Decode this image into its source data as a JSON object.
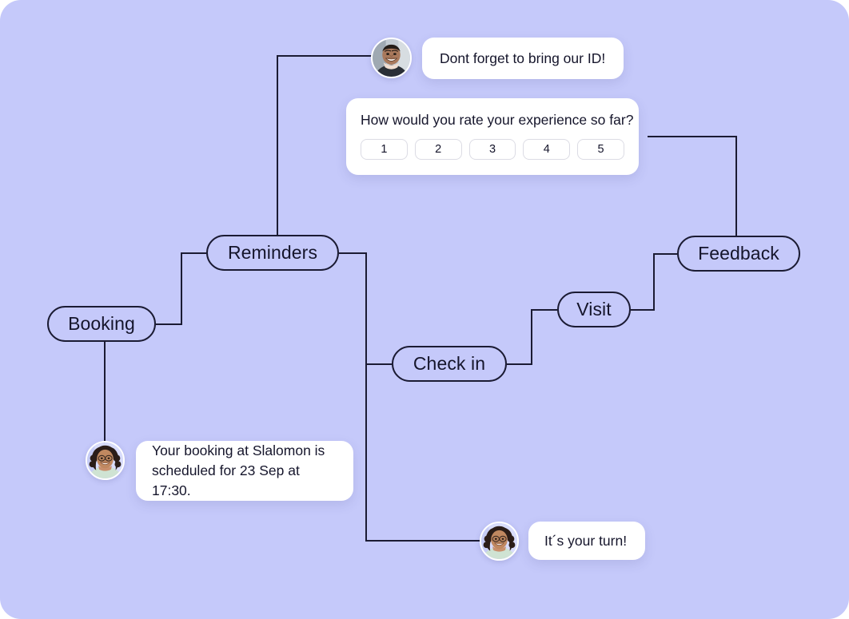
{
  "canvas": {
    "background_color": "#c5c9fa",
    "line_color": "#1b1b33",
    "bubble_color": "#ffffff",
    "text_color": "#15152b"
  },
  "flow": {
    "nodes": [
      {
        "id": "booking",
        "label": "Booking"
      },
      {
        "id": "reminders",
        "label": "Reminders"
      },
      {
        "id": "checkin",
        "label": "Check in"
      },
      {
        "id": "visit",
        "label": "Visit"
      },
      {
        "id": "feedback",
        "label": "Feedback"
      }
    ]
  },
  "messages": {
    "reminder_id": {
      "text": "Dont forget to bring our ID!",
      "avatar": "man-smiling-avatar"
    },
    "booking_confirmation": {
      "text": "Your booking at Slalomon is scheduled for 23 Sep at 17:30.",
      "avatar": "woman-glasses-avatar"
    },
    "your_turn": {
      "text": "It´s your turn!",
      "avatar": "woman-glasses-avatar"
    }
  },
  "rating_card": {
    "question": "How would you rate your experience so far?",
    "options": [
      "1",
      "2",
      "3",
      "4",
      "5"
    ]
  }
}
